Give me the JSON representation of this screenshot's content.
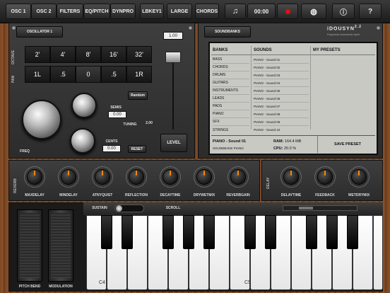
{
  "topbar": {
    "tabs": [
      "OSC 1",
      "OSC 2",
      "FILTERS",
      "EQ/PITCH",
      "DYNPRO"
    ],
    "kb_buttons": [
      "LBKEY1",
      "LARGE",
      "CHORDS"
    ],
    "time": "00:00"
  },
  "osc": {
    "title": "OSCILLATOR 1",
    "octave_label": "OCTAVE",
    "pan_label": "PAN",
    "octave_values": [
      "2'",
      "4'",
      "8'",
      "16'",
      "32'"
    ],
    "pan_values": [
      "1L",
      ".5",
      "0",
      ".5",
      "1R"
    ],
    "level_value": "1.00",
    "level_label": "LEVEL",
    "random_label": "Random",
    "semis_label": "SEMIS",
    "semis_value": "0.00",
    "tuning_label": "TUNING",
    "tuning_value": "2.00",
    "cents_label": "CENTS",
    "cents_value": "0.00",
    "reset_label": "RESET",
    "freq_label": "FREQ"
  },
  "soundbanks": {
    "header": "SOUNDBANKS",
    "logo": "iDOUSYN",
    "logo_version": "2.2",
    "logo_sub": "Polyphonic Instruments Synth",
    "col_banks": "BANKS",
    "col_sounds": "SOUNDS",
    "col_presets": "MY PRESETS",
    "banks": [
      "BASS",
      "CHORDS",
      "DRUMS",
      "GUITARS",
      "INSTRUMENTS",
      "LEADS",
      "PADS",
      "PIANO",
      "SFX",
      "STRINGS"
    ],
    "sounds": [
      "PIANO - Sound 01",
      "PIANO - Sound 02",
      "PIANO - Sound 03",
      "PIANO - Sound 04",
      "PIANO - Sound 05",
      "PIANO - Sound 06",
      "PIANO - Sound 07",
      "PIANO - Sound 08",
      "PIANO - Sound 09",
      "PIANO - Sound 10"
    ],
    "current_sound": "PIANO - Sound 01",
    "current_bank": "SOUNDBANK PIANO",
    "ram_label": "RAM:",
    "ram_value": "164.4 MB",
    "cpu_label": "CPU:",
    "cpu_value": "20.0 %",
    "save_preset": "SAVE PRESET"
  },
  "reverb": {
    "section_label": "REVERB",
    "knobs": [
      "MAXDELAY",
      "MINDELAY",
      "ATNYQUIST",
      "REFLECTION",
      "DECAYTIME",
      "DRYWETMIX",
      "REVERBGAIN"
    ]
  },
  "delay": {
    "section_label": "DELAY",
    "knobs": [
      "DELAYTIME",
      "FEEDBACK",
      "WETDRYMIX"
    ]
  },
  "keyboard": {
    "sustain_label": "SUSTAIN",
    "scroll_label": "SCROLL",
    "pitch_bend_label": "PITCH BEND",
    "modulation_label": "MODULATION",
    "c4_label": "C4",
    "c5_label": "C5"
  },
  "colors": {
    "accent": "#ff8a00",
    "record": "#e01010",
    "screen": "#c9c9c4"
  }
}
